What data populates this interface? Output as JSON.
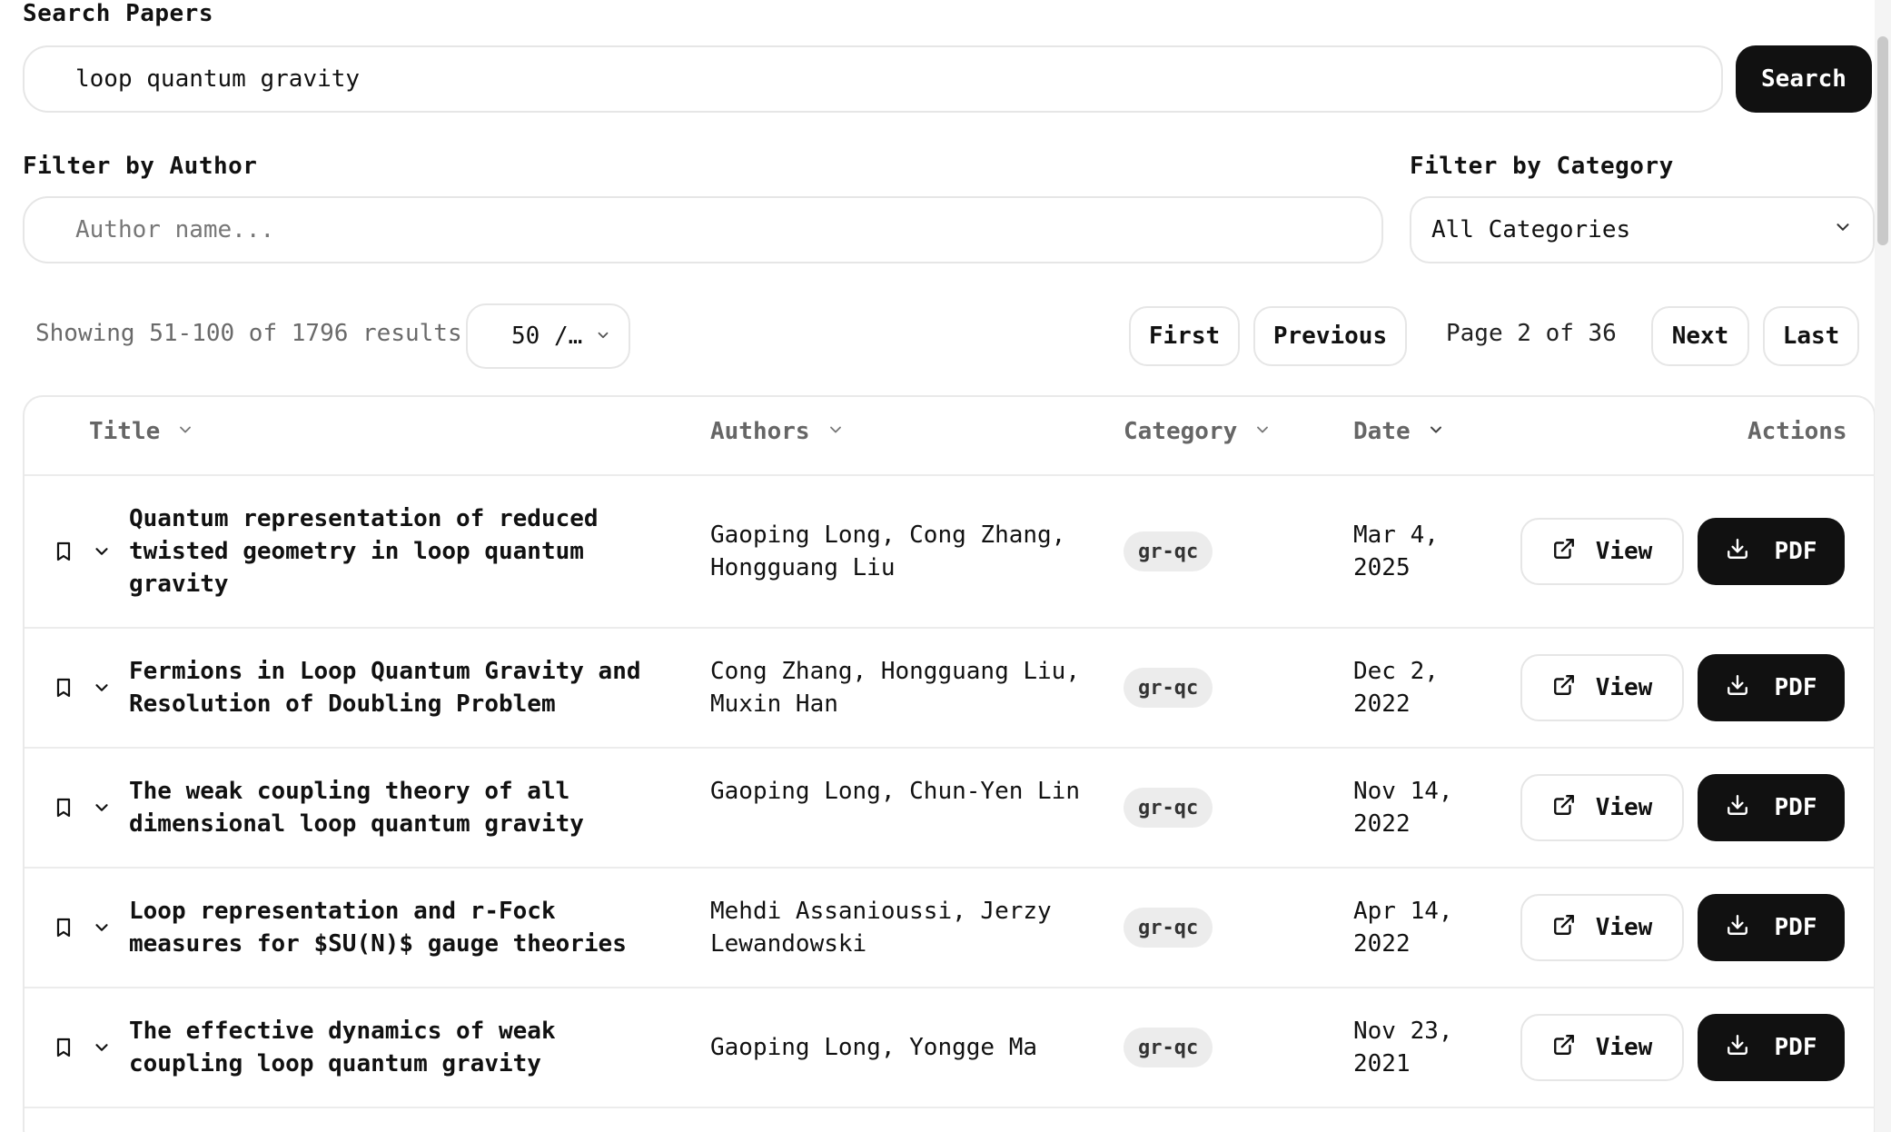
{
  "search": {
    "label": "Search Papers",
    "value": "loop quantum gravity",
    "button": "Search"
  },
  "author_filter": {
    "label": "Filter by Author",
    "placeholder": "Author name..."
  },
  "category_filter": {
    "label": "Filter by Category",
    "selected": "All Categories"
  },
  "pagination": {
    "showing": "Showing 51-100 of 1796 results",
    "per_page": "50 /…",
    "first": "First",
    "previous": "Previous",
    "page_info": "Page 2 of 36",
    "next": "Next",
    "last": "Last"
  },
  "table": {
    "headers": {
      "title": "Title",
      "authors": "Authors",
      "category": "Category",
      "date": "Date",
      "actions": "Actions"
    },
    "view_label": "View",
    "pdf_label": "PDF",
    "rows": [
      {
        "title": "Quantum representation of reduced twisted geometry in loop quantum gravity",
        "authors": "Gaoping Long, Cong Zhang, Hongguang Liu",
        "category": "gr-qc",
        "date": "Mar 4, 2025"
      },
      {
        "title": "Fermions in Loop Quantum Gravity and Resolution of Doubling Problem",
        "authors": "Cong Zhang, Hongguang Liu, Muxin Han",
        "category": "gr-qc",
        "date": "Dec 2, 2022"
      },
      {
        "title": "The weak coupling theory of all dimensional loop quantum gravity",
        "authors": "Gaoping Long, Chun-Yen Lin",
        "category": "gr-qc",
        "date": "Nov 14, 2022"
      },
      {
        "title": "Loop representation and r-Fock measures for $SU(N)$ gauge theories",
        "authors": "Mehdi Assanioussi, Jerzy Lewandowski",
        "category": "gr-qc",
        "date": "Apr 14, 2022"
      },
      {
        "title": "The effective dynamics of weak coupling loop quantum gravity",
        "authors": "Gaoping Long, Yongge Ma",
        "category": "gr-qc",
        "date": "Nov 23, 2021"
      }
    ]
  }
}
